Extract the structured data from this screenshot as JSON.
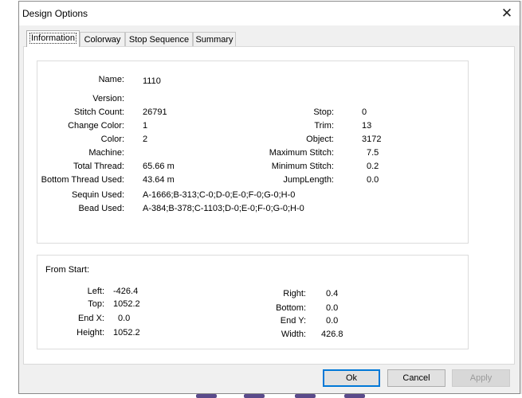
{
  "window": {
    "title": "Design Options",
    "close_glyph": "✕"
  },
  "tabs": [
    {
      "label": "Information",
      "active": true
    },
    {
      "label": "Colorway",
      "active": false
    },
    {
      "label": "Stop Sequence",
      "active": false
    },
    {
      "label": "Summary",
      "active": false
    }
  ],
  "info": {
    "left": [
      {
        "label": "Name:",
        "value": "1110"
      },
      {
        "label": "Version:",
        "value": ""
      },
      {
        "label": "Stitch Count:",
        "value": "26791"
      },
      {
        "label": "Change Color:",
        "value": "1"
      },
      {
        "label": "Color:",
        "value": "2"
      },
      {
        "label": "Machine:",
        "value": ""
      },
      {
        "label": "Total Thread:",
        "value": "65.66 m"
      },
      {
        "label": "Bottom Thread Used:",
        "value": "43.64 m"
      },
      {
        "label": "Sequin Used:",
        "value": "A-1666;B-313;C-0;D-0;E-0;F-0;G-0;H-0"
      },
      {
        "label": "Bead Used:",
        "value": "A-384;B-378;C-1103;D-0;E-0;F-0;G-0;H-0"
      }
    ],
    "right": [
      {
        "label": "Stop:",
        "value": "0"
      },
      {
        "label": "Trim:",
        "value": "13"
      },
      {
        "label": "Object:",
        "value": "3172"
      },
      {
        "label": "Maximum Stitch:",
        "value": "7.5"
      },
      {
        "label": "Minimum Stitch:",
        "value": "0.2"
      },
      {
        "label": "JumpLength:",
        "value": "0.0"
      }
    ]
  },
  "from_start": {
    "heading": "From Start:",
    "left": [
      {
        "label": "Left:",
        "value": "-426.4"
      },
      {
        "label": "Top:",
        "value": "1052.2"
      },
      {
        "label": "End X:",
        "value": "0.0"
      },
      {
        "label": "Height:",
        "value": "1052.2"
      }
    ],
    "right": [
      {
        "label": "Right:",
        "value": "0.4"
      },
      {
        "label": "Bottom:",
        "value": "0.0"
      },
      {
        "label": "End Y:",
        "value": "0.0"
      },
      {
        "label": "Width:",
        "value": "426.8"
      }
    ]
  },
  "buttons": {
    "ok": "Ok",
    "cancel": "Cancel",
    "apply": "Apply"
  }
}
